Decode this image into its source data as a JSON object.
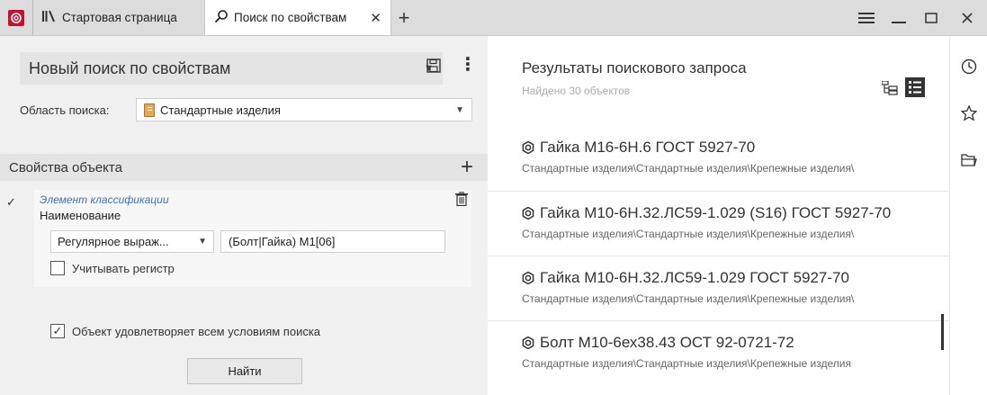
{
  "tabs": {
    "home_label": "Стартовая страница",
    "search_label": "Поиск по свойствам"
  },
  "search": {
    "title": "Новый поиск по свойствам",
    "area_label": "Область поиска:",
    "area_value": "Стандартные изделия"
  },
  "properties": {
    "header": "Свойства объекта",
    "condition": {
      "category": "Элемент классификации",
      "attribute": "Наименование",
      "operator": "Регулярное выраж...",
      "value": "(Болт|Гайка) М1[06]",
      "case_label": "Учитывать регистр",
      "case_checked": false
    }
  },
  "all_conditions_label": "Объект удовлетворяет всем условиям поиска",
  "all_conditions_checked": true,
  "find_label": "Найти",
  "results": {
    "title": "Результаты поискового запроса",
    "count": "Найдено 30 объектов",
    "items": [
      {
        "name": "Гайка М16-6Н.6 ГОСТ 5927-70",
        "path": "Стандартные изделия\\Стандартные изделия\\Крепежные изделия\\"
      },
      {
        "name": "Гайка М10-6Н.32.ЛС59-1.029 (S16) ГОСТ 5927-70",
        "path": "Стандартные изделия\\Стандартные изделия\\Крепежные изделия\\"
      },
      {
        "name": "Гайка М10-6Н.32.ЛС59-1.029 ГОСТ 5927-70",
        "path": "Стандартные изделия\\Стандартные изделия\\Крепежные изделия\\"
      },
      {
        "name": "Болт М10-6ех38.43 ОСТ 92-0721-72",
        "path": "Стандартные изделия\\Стандартные изделия\\Крепежные изделия"
      }
    ]
  },
  "colors": {
    "brand": "#c8102e",
    "link": "#3b73b9"
  },
  "icons": [
    "app-logo-icon",
    "library-icon",
    "search-icon",
    "close-icon",
    "plus-icon",
    "menu-icon",
    "minimize-icon",
    "maximize-icon",
    "close-window-icon",
    "save-icon",
    "more-icon",
    "book-icon",
    "trash-icon",
    "check-icon",
    "tree-view-icon",
    "list-view-icon",
    "nut-icon",
    "history-icon",
    "star-icon",
    "folder-icon"
  ]
}
